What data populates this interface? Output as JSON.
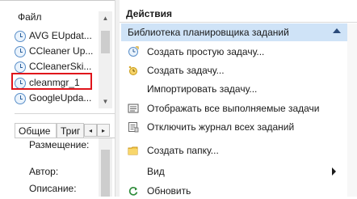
{
  "left": {
    "file_header": "Файл",
    "tasks": [
      {
        "label": "AVG EUpdat...",
        "icon": "clock-icon"
      },
      {
        "label": "CCleaner Up...",
        "icon": "clock-icon"
      },
      {
        "label": "CCleanerSki...",
        "icon": "clock-icon"
      },
      {
        "label": "cleanmgr_1",
        "icon": "clock-icon",
        "highlighted": true
      },
      {
        "label": "GoogleUpda...",
        "icon": "clock-icon"
      }
    ],
    "tabs": {
      "general": "Общие",
      "triggers": "Триг",
      "prev_arrow": "◂",
      "next_arrow": "▸"
    },
    "properties": {
      "location": "Размещение:",
      "author": "Автор:",
      "description": "Описание:"
    }
  },
  "right": {
    "actions_header": "Действия",
    "section_title": "Библиотека планировщика заданий",
    "actions": [
      {
        "label": "Создать простую задачу...",
        "icon": "create-basic-task-icon"
      },
      {
        "label": "Создать задачу...",
        "icon": "create-task-icon"
      },
      {
        "label": "Импортировать задачу...",
        "icon": ""
      },
      {
        "label": "Отображать все выполняемые задачи",
        "icon": "running-tasks-icon"
      },
      {
        "label": "Отключить журнал всех заданий",
        "icon": "disable-history-icon"
      },
      {
        "label": "Создать папку...",
        "icon": "new-folder-icon"
      },
      {
        "label": "Вид",
        "icon": "",
        "submenu": true
      },
      {
        "label": "Обновить",
        "icon": "refresh-icon"
      }
    ]
  },
  "colors": {
    "highlight_border": "#e0141b",
    "section_bar": "#cfe3f7"
  }
}
